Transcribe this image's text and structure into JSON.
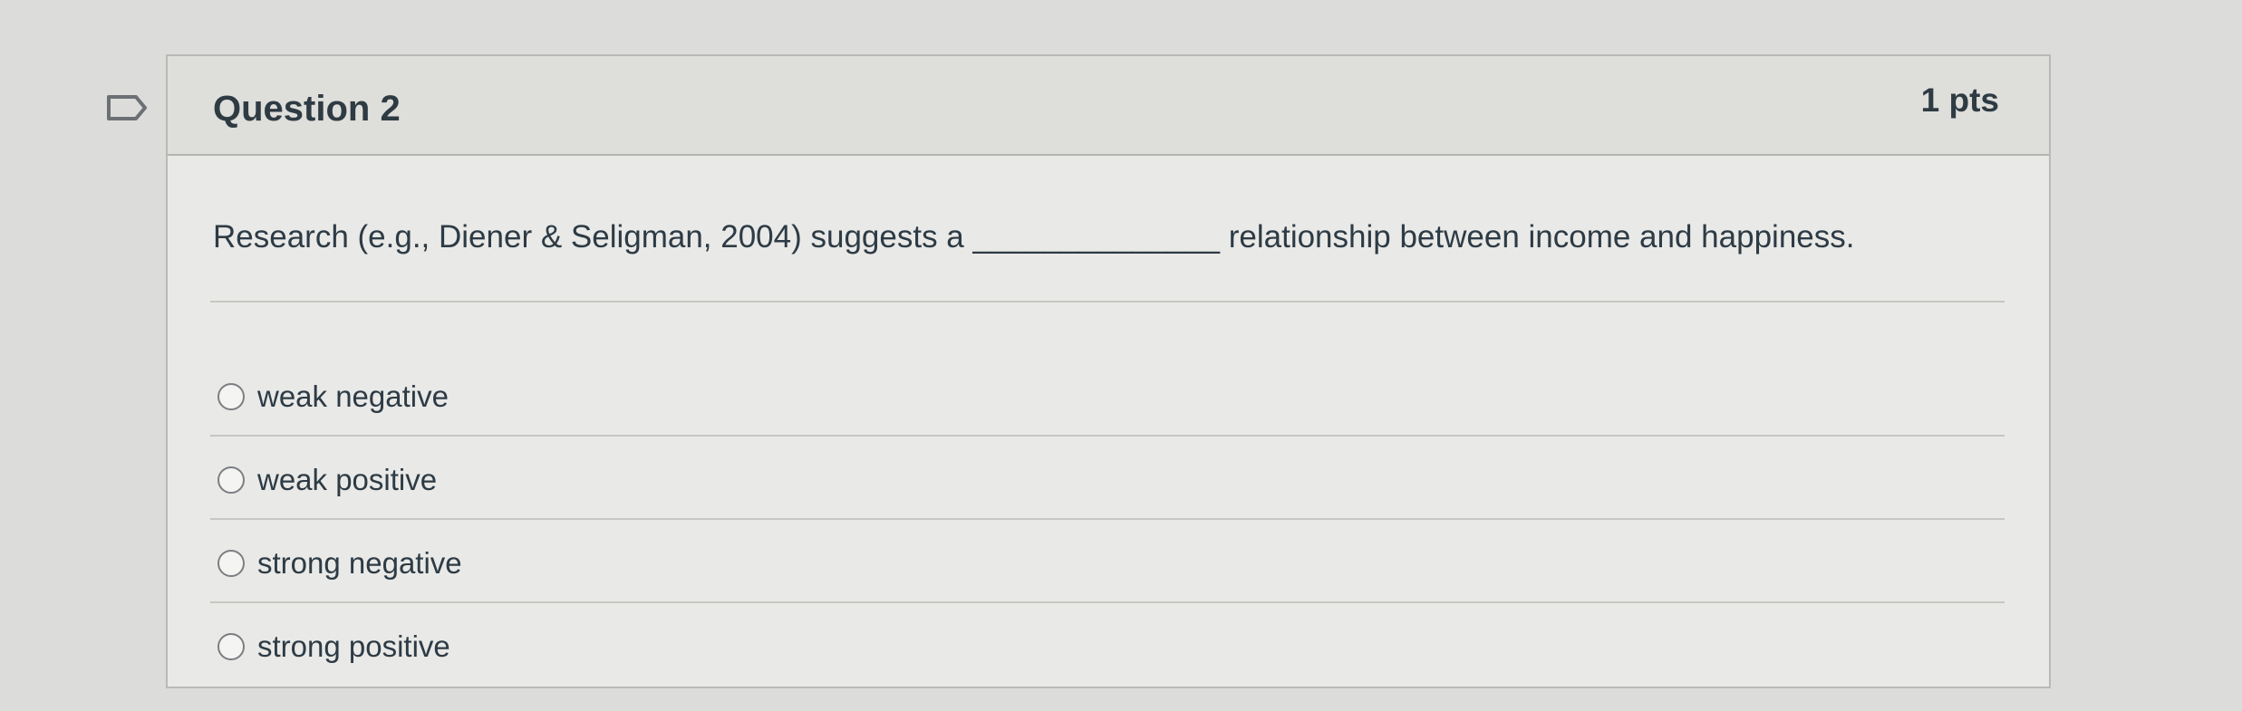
{
  "question": {
    "title": "Question 2",
    "points": "1 pts",
    "text": "Research (e.g., Diener & Seligman, 2004) suggests a ______________ relationship between income and happiness."
  },
  "answers": [
    {
      "label": "weak negative"
    },
    {
      "label": "weak positive"
    },
    {
      "label": "strong negative"
    },
    {
      "label": "strong positive"
    }
  ],
  "icons": {
    "flag": "flag-icon"
  }
}
